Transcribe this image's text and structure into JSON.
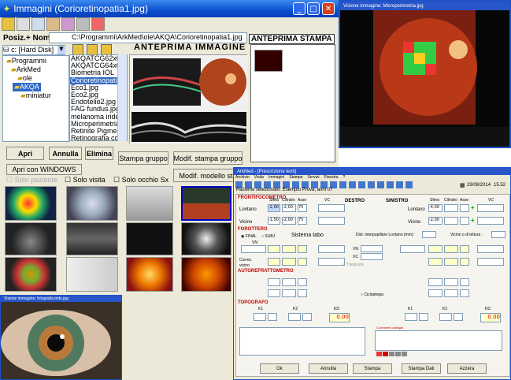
{
  "main": {
    "title": "Immagini  (Corioretinopatia1.jpg)",
    "posiz_label": "Posiz.+ Nome:",
    "path_value": "C:\\Programmi\\ArkMed\\ole\\AKQA\\Corioretinopatia1.jpg",
    "drive": "c: [Hard Disk]",
    "folders": [
      "Programmi",
      "ArkMed",
      "ole",
      "AKQA",
      "miniatur"
    ],
    "files": [
      "AKQATCG62x0",
      "AKQATCG64x0",
      "Biometria IOL",
      "Corioretinopatia",
      "Eco1.jpg",
      "Eco2.jpg",
      "Endotelio2.jpg",
      "FAG fundus.jpg",
      "melanoma iride",
      "Microperimetria",
      "Retinite Pigmer",
      "Retinografia cc"
    ],
    "selected_file": "Corioretinopatia",
    "preview_title": "ANTEPRIMA IMMAGINE",
    "print_title": "ANTEPRIMA STAMPA",
    "buttons": {
      "apri": "Apri",
      "annulla": "Annulla",
      "elimina": "Elimina",
      "stampa_gruppo": "Stampa gruppo",
      "modif_stampa": "Modif. stampa gruppo",
      "apri_windows": "Apri con WINDOWS",
      "modif_modello": "Modif. modello sta"
    },
    "checks": [
      "Solo paziente",
      "Solo visita",
      "Solo occhio Sx"
    ]
  },
  "micro": {
    "title": "Visione immagine: Microperimetria.jpg"
  },
  "iris": {
    "title": "Visione immagine: fotografia iride.jpg"
  },
  "form": {
    "title": "ArkMed - [Prescrizione lenti]",
    "menu": [
      "Archivio",
      "Visita",
      "Immagini",
      "Stampa",
      "Servizi",
      "Finestra",
      "?"
    ],
    "date": "29/08/2014",
    "time": "15.52",
    "patient": "Paziente selezionato: Esempio Prova,  anni 07",
    "frontifocometro": "FRONTIFOCOMETRO",
    "destro": "DESTRO",
    "sinistro": "SINISTRO",
    "sfera": "Sfera",
    "cilindro": "Cilindro",
    "asse": "Asse",
    "vc": "VC",
    "lontano": "Lontano",
    "vicino": "Vicino",
    "dx_lontano": [
      "-2,00",
      "-2,00",
      "75"
    ],
    "dx_vicino": [
      "-1,50",
      "-2,00",
      "75"
    ],
    "sx_lontano": "-4,00",
    "sx_vicino": "-2,00",
    "forottero": "FOROTTERO",
    "final": "FINAL",
    "subj": "SUBJ",
    "sistema": "Sistema tabo",
    "dist_label": "Dist. interpupillare Lontano (mm):",
    "vicino_lettura": "Vicino o di lettura :",
    "vn": "VN",
    "correz": "Correz.",
    "vicino2": "vicino",
    "trasposta": "Trasposta",
    "autorefrattometro": "AUTOREFRATTOMETRO",
    "cicloplegia": "Cicloplegia",
    "topografo": "TOPOGRAFO",
    "k1": "K1",
    "k2": "K2",
    "kd": "KD",
    "kd_val": "0.00",
    "commenti": "Commenti collegati",
    "buttons": [
      "Ok",
      "Annulla",
      "Stampa",
      "Stampa Dati",
      "Azzera"
    ]
  },
  "colors": {
    "xp_blue": "#2b5de0",
    "form_red": "#c00000",
    "panel": "#ece9d8"
  }
}
